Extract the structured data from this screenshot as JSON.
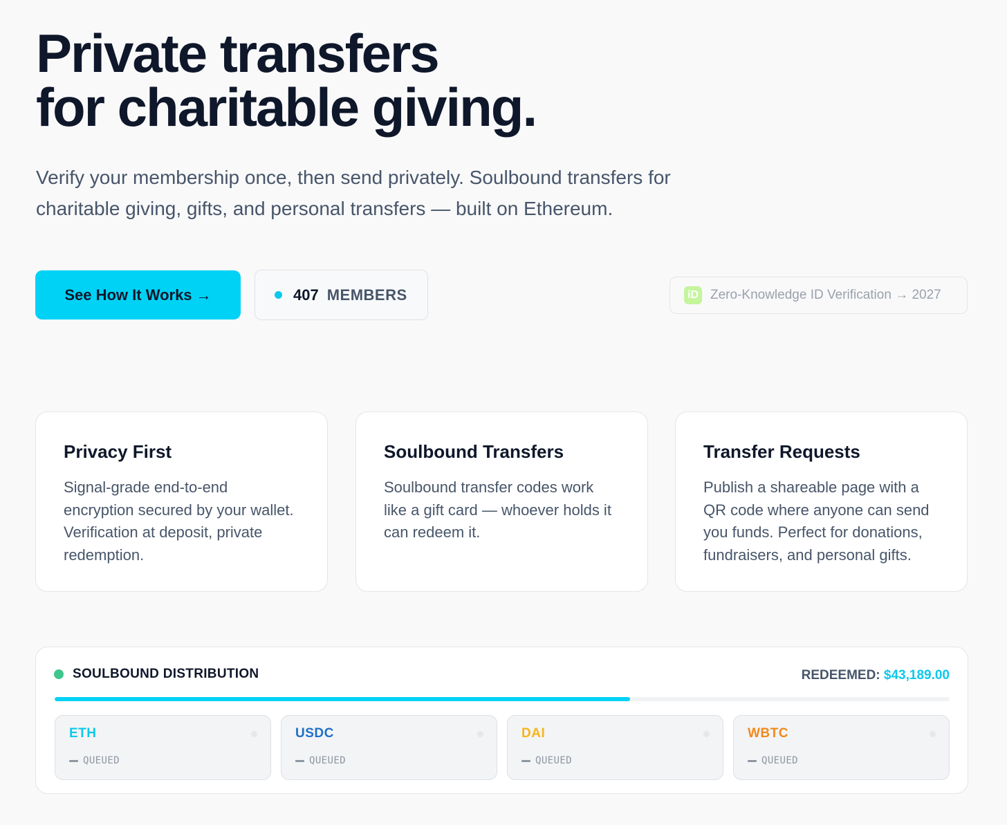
{
  "hero": {
    "title_line1": "Private transfers",
    "title_line2": "for charitable giving.",
    "subtitle": "Verify your membership once, then send privately. Soulbound transfers for charitable giving, gifts, and personal transfers — built on Ethereum."
  },
  "actions": {
    "cta_label": "See How It Works →",
    "members_count": "407",
    "members_label": "MEMBERS",
    "zk_badge_icon_text": "iD",
    "zk_label": "Zero-Knowledge ID Verification → 2027"
  },
  "features": [
    {
      "title": "Privacy First",
      "body": "Signal-grade end-to-end encryption secured by your wallet. Verification at deposit, private redemption."
    },
    {
      "title": "Soulbound Transfers",
      "body": "Soulbound transfer codes work like a gift card — whoever holds it can redeem it."
    },
    {
      "title": "Transfer Requests",
      "body": "Publish a shareable page with a QR code where anyone can send you funds. Perfect for donations, fundraisers, and personal gifts."
    }
  ],
  "distribution": {
    "title": "SOULBOUND DISTRIBUTION",
    "redeemed_label": "REDEEMED:",
    "redeemed_amount": "$43,189.00",
    "progress_fraction": 0.643,
    "tokens": [
      {
        "symbol": "ETH",
        "status": "QUEUED",
        "color": "#0cc8ec"
      },
      {
        "symbol": "USDC",
        "status": "QUEUED",
        "color": "#1f6fc9"
      },
      {
        "symbol": "DAI",
        "status": "QUEUED",
        "color": "#f5b51a"
      },
      {
        "symbol": "WBTC",
        "status": "QUEUED",
        "color": "#f08a1c"
      }
    ]
  },
  "colors": {
    "accent": "#00d2f6",
    "status_dot": "#3fc68c",
    "zk_badge": "#c4f59c"
  }
}
